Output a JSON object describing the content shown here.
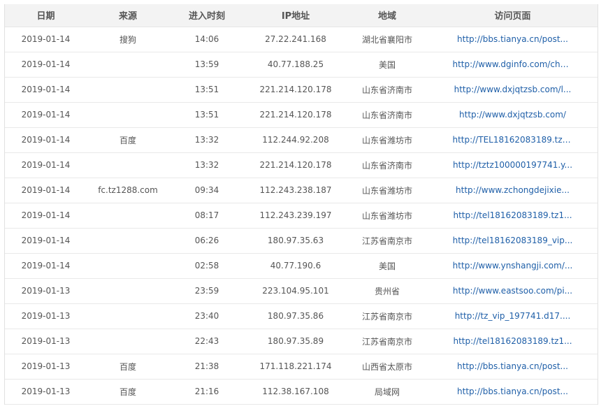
{
  "table": {
    "headers": {
      "date": "日期",
      "source": "来源",
      "entry_time": "进入时刻",
      "ip": "IP地址",
      "region": "地域",
      "page": "访问页面"
    },
    "rows": [
      {
        "date": "2019-01-14",
        "source": "搜狗",
        "time": "14:06",
        "ip": "27.22.241.168",
        "region": "湖北省襄阳市",
        "url": "http://bbs.tianya.cn/post..."
      },
      {
        "date": "2019-01-14",
        "source": "",
        "time": "13:59",
        "ip": "40.77.188.25",
        "region": "美国",
        "url": "http://www.dginfo.com/cha..."
      },
      {
        "date": "2019-01-14",
        "source": "",
        "time": "13:51",
        "ip": "221.214.120.178",
        "region": "山东省济南市",
        "url": "http://www.dxjqtzsb.com/l..."
      },
      {
        "date": "2019-01-14",
        "source": "",
        "time": "13:51",
        "ip": "221.214.120.178",
        "region": "山东省济南市",
        "url": "http://www.dxjqtzsb.com/"
      },
      {
        "date": "2019-01-14",
        "source": "百度",
        "time": "13:32",
        "ip": "112.244.92.208",
        "region": "山东省潍坊市",
        "url": "http://TEL18162083189.tz1..."
      },
      {
        "date": "2019-01-14",
        "source": "",
        "time": "13:32",
        "ip": "221.214.120.178",
        "region": "山东省济南市",
        "url": "http://tztz100000197741.y..."
      },
      {
        "date": "2019-01-14",
        "source": "fc.tz1288.com",
        "time": "09:34",
        "ip": "112.243.238.187",
        "region": "山东省潍坊市",
        "url": "http://www.zchongdejixie..."
      },
      {
        "date": "2019-01-14",
        "source": "",
        "time": "08:17",
        "ip": "112.243.239.197",
        "region": "山东省潍坊市",
        "url": "http://tel18162083189.tz1..."
      },
      {
        "date": "2019-01-14",
        "source": "",
        "time": "06:26",
        "ip": "180.97.35.63",
        "region": "江苏省南京市",
        "url": "http://tel18162083189_vip..."
      },
      {
        "date": "2019-01-14",
        "source": "",
        "time": "02:58",
        "ip": "40.77.190.6",
        "region": "美国",
        "url": "http://www.ynshangji.com/..."
      },
      {
        "date": "2019-01-13",
        "source": "",
        "time": "23:59",
        "ip": "223.104.95.101",
        "region": "贵州省",
        "url": "http://www.eastsoo.com/pi..."
      },
      {
        "date": "2019-01-13",
        "source": "",
        "time": "23:40",
        "ip": "180.97.35.86",
        "region": "江苏省南京市",
        "url": "http://tz_vip_197741.d17...."
      },
      {
        "date": "2019-01-13",
        "source": "",
        "time": "22:43",
        "ip": "180.97.35.89",
        "region": "江苏省南京市",
        "url": "http://tel18162083189.tz1..."
      },
      {
        "date": "2019-01-13",
        "source": "百度",
        "time": "21:38",
        "ip": "171.118.221.174",
        "region": "山西省太原市",
        "url": "http://bbs.tianya.cn/post..."
      },
      {
        "date": "2019-01-13",
        "source": "百度",
        "time": "21:16",
        "ip": "112.38.167.108",
        "region": "局域网",
        "url": "http://bbs.tianya.cn/post..."
      }
    ]
  }
}
